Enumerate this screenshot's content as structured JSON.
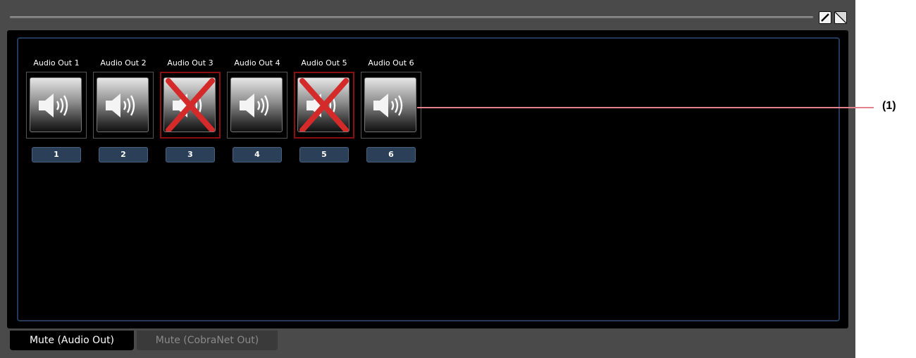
{
  "window": {
    "buttons": [
      {
        "icon": "pencil-icon"
      },
      {
        "icon": "resize-icon"
      }
    ]
  },
  "channels": [
    {
      "label": "Audio Out 1",
      "number": "1",
      "muted": false,
      "icon": "speaker-icon"
    },
    {
      "label": "Audio Out 2",
      "number": "2",
      "muted": false,
      "icon": "speaker-icon"
    },
    {
      "label": "Audio Out 3",
      "number": "3",
      "muted": true,
      "icon": "speaker-muted-icon"
    },
    {
      "label": "Audio Out 4",
      "number": "4",
      "muted": false,
      "icon": "speaker-icon"
    },
    {
      "label": "Audio Out 5",
      "number": "5",
      "muted": true,
      "icon": "speaker-muted-icon"
    },
    {
      "label": "Audio Out 6",
      "number": "6",
      "muted": false,
      "icon": "speaker-icon"
    }
  ],
  "tabs": [
    {
      "label": "Mute (Audio Out)",
      "active": true
    },
    {
      "label": "Mute (CobraNet Out)",
      "active": false
    }
  ],
  "callout": {
    "label": "(1)"
  },
  "colors": {
    "panel_bg": "#000000",
    "window_bg": "#4a4a4a",
    "badge_bg": "#2b3f58",
    "mute_x": "#d42a2a",
    "muted_border": "#8b0f0f",
    "callout_line": "#e3808a"
  }
}
